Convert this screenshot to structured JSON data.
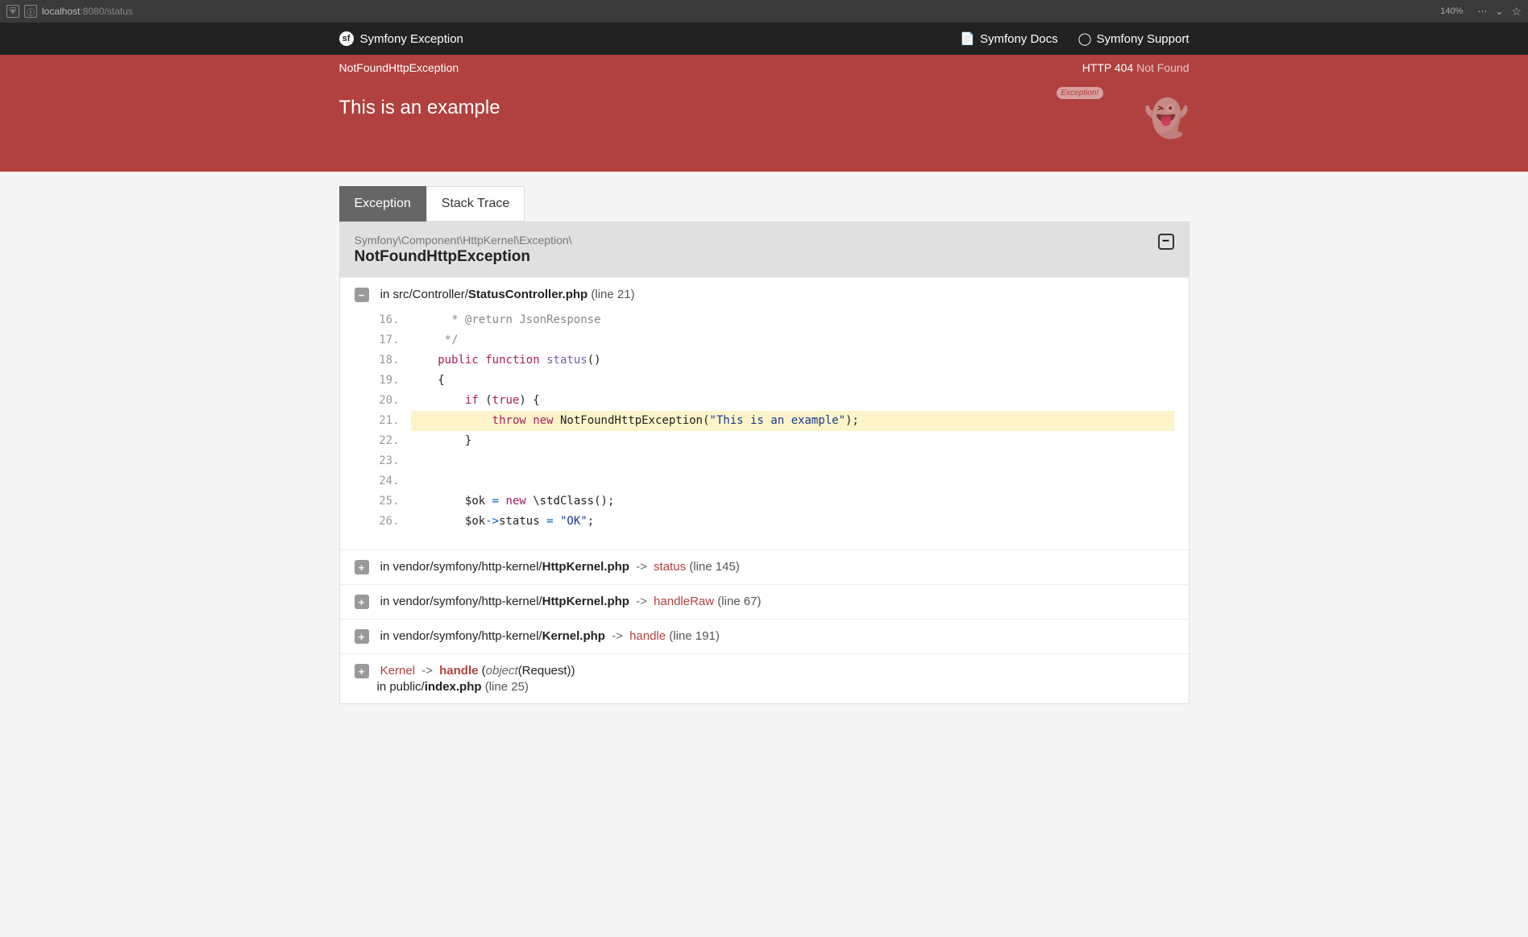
{
  "browser": {
    "url_host": "localhost",
    "url_port": ":8080",
    "url_path": "/status",
    "zoom": "140%"
  },
  "topnav": {
    "brand": "Symfony Exception",
    "docs": "Symfony Docs",
    "support": "Symfony Support"
  },
  "subbar": {
    "exception_class": "NotFoundHttpException",
    "http_code": "HTTP 404",
    "http_text": "Not Found"
  },
  "hero": {
    "message": "This is an example",
    "bubble": "Exception!"
  },
  "tabs": {
    "exception": "Exception",
    "stack_trace": "Stack Trace"
  },
  "panel": {
    "namespace": "Symfony\\Component\\HttpKernel\\Exception\\",
    "class_name": "NotFoundHttpException"
  },
  "trace0": {
    "in": "in ",
    "path": "src/Controller/",
    "file": "StatusController.php",
    "line_info": " (line 21)"
  },
  "code_lines": [
    {
      "n": "16.",
      "html": "      <span class='t-comment'>* @return JsonResponse</span>",
      "hl": false
    },
    {
      "n": "17.",
      "html": "     <span class='t-comment'>*/</span>",
      "hl": false
    },
    {
      "n": "18.",
      "html": "    <span class='t-keyword'>public</span> <span class='t-keyword'>function</span> <span class='t-func'>status</span>()",
      "hl": false
    },
    {
      "n": "19.",
      "html": "    {",
      "hl": false
    },
    {
      "n": "20.",
      "html": "        <span class='t-keyword'>if</span> (<span class='t-keyword'>true</span>) {",
      "hl": false
    },
    {
      "n": "21.",
      "html": "            <span class='t-keyword'>throw</span> <span class='t-keyword'>new</span> NotFoundHttpException(<span class='t-string'>\"This is an example\"</span>);",
      "hl": true
    },
    {
      "n": "22.",
      "html": "        }",
      "hl": false
    },
    {
      "n": "23.",
      "html": "",
      "hl": false
    },
    {
      "n": "24.",
      "html": "",
      "hl": false
    },
    {
      "n": "25.",
      "html": "        $ok <span class='t-punct'>=</span> <span class='t-keyword'>new</span> \\stdClass();",
      "hl": false
    },
    {
      "n": "26.",
      "html": "        $ok<span class='t-punct'>-></span>status <span class='t-punct'>=</span> <span class='t-string'>\"OK\"</span>;",
      "hl": false
    }
  ],
  "trace1": {
    "in": "in ",
    "path": "vendor/symfony/http-kernel/",
    "file": "HttpKernel.php",
    "arrow": "->",
    "method": "status",
    "line_info": " (line 145)"
  },
  "trace2": {
    "in": "in ",
    "path": "vendor/symfony/http-kernel/",
    "file": "HttpKernel.php",
    "arrow": "->",
    "method": "handleRaw",
    "line_info": " (line 67)"
  },
  "trace3": {
    "in": "in ",
    "path": "vendor/symfony/http-kernel/",
    "file": "Kernel.php",
    "arrow": "->",
    "method": "handle",
    "line_info": " (line 191)"
  },
  "trace4": {
    "kernel": "Kernel",
    "arrow": "->",
    "method": "handle",
    "open": " (",
    "obj": "object",
    "req": "(Request))",
    "sub_in": "in ",
    "sub_path": "public/",
    "sub_file": "index.php",
    "sub_line": " (line 25)"
  }
}
